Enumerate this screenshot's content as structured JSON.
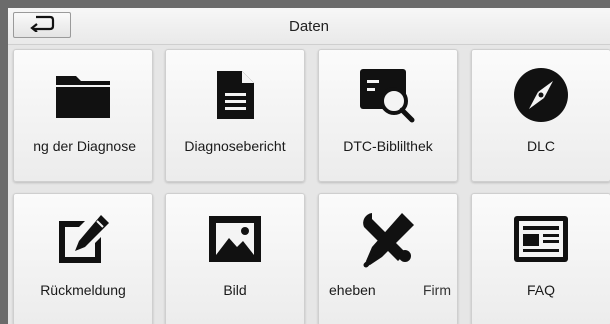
{
  "header": {
    "title": "Daten",
    "back_icon": "return-arrow-icon"
  },
  "tiles": [
    {
      "label": "ng der Diagnose",
      "icon": "folder-icon"
    },
    {
      "label": "Diagnosebericht",
      "icon": "document-icon"
    },
    {
      "label": "DTC-Biblilthek",
      "icon": "search-document-icon"
    },
    {
      "label": "DLC",
      "icon": "compass-icon"
    },
    {
      "label": "Rückmeldung",
      "icon": "pencil-icon"
    },
    {
      "label": "Bild",
      "icon": "image-icon"
    },
    {
      "label_left": "eheben",
      "label_right": "Firm",
      "icon": "tools-icon"
    },
    {
      "label": "FAQ",
      "icon": "newspaper-icon"
    }
  ],
  "colors": {
    "icon": "#111111",
    "tile_bg": "#f4f4f4",
    "screen_bg": "#e6e6e6"
  }
}
